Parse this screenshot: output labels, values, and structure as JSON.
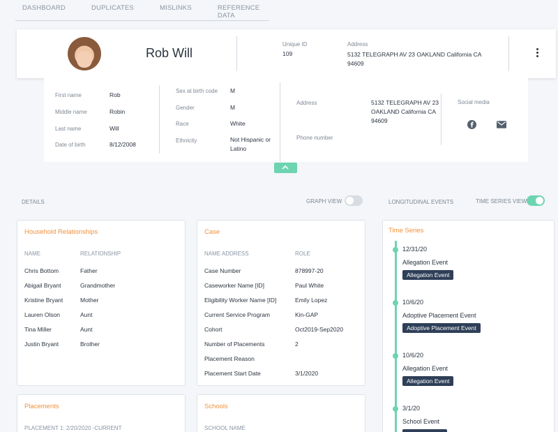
{
  "nav": {
    "tabs": [
      "DASHBOARD",
      "DUPLICATES",
      "MISLINKS",
      "REFERENCE DATA"
    ]
  },
  "profile": {
    "name": "Rob Will",
    "unique_id_label": "Unique ID",
    "unique_id": "109",
    "address_label": "Address",
    "address_line1": "5132 TELEGRAPH AV 23 OAKLAND California CA",
    "address_line2": "94609"
  },
  "details": {
    "first_name_label": "First name",
    "first_name": "Rob",
    "middle_name_label": "Middle name",
    "middle_name": "Robin",
    "last_name_label": "Last name",
    "last_name": "Will",
    "dob_label": "Date of birth",
    "dob": "8/12/2008",
    "sex_label": "Sex at birth code",
    "sex": "M",
    "gender_label": "Gender",
    "gender": "M",
    "race_label": "Race",
    "race": "White",
    "ethnicity_label": "Ethnicity",
    "ethnicity_line1": "Not Hispanic or",
    "ethnicity_line2": "Latino",
    "address_label": "Address",
    "address_line1": "5132 TELEGRAPH AV 23",
    "address_line2": "OAKLAND California CA",
    "address_line3": "94609",
    "phone_label": "Phone number",
    "social_label": "Social media",
    "social_icons": [
      "facebook-icon",
      "mail-icon"
    ]
  },
  "section": {
    "details_label": "DETAILS",
    "graph_view_label": "GRAPH VIEW",
    "graph_view_on": false,
    "longitudinal_label": "LONGITUDINAL EVENTS",
    "time_series_view_label": "TIME SERIES VIEW",
    "time_series_view_on": true
  },
  "household": {
    "title": "Household Relationships",
    "col_name": "NAME",
    "col_relationship": "RELATIONSHIP",
    "rows": [
      {
        "name": "Chris Bottom",
        "relationship": "Father"
      },
      {
        "name": "Abigail Bryant",
        "relationship": "Grandmother"
      },
      {
        "name": "Kristine Bryant",
        "relationship": "Mother"
      },
      {
        "name": "Lauren Olson",
        "relationship": "Aunt"
      },
      {
        "name": "Tina Miller",
        "relationship": "Aunt"
      },
      {
        "name": "Justin Bryant",
        "relationship": "Brother"
      }
    ]
  },
  "case": {
    "title": "Case",
    "col_name": "NAME ADDRESS",
    "col_role": "ROLE",
    "rows": [
      {
        "name": "Case Number",
        "role": "878997-20"
      },
      {
        "name": "Caseworker Name [ID]",
        "role": "Paul White"
      },
      {
        "name": "Eligibility Worker Name [ID]",
        "role": "Emily Lopez"
      },
      {
        "name": "Current Service Program",
        "role": "Kin-GAP"
      },
      {
        "name": "Cohort",
        "role": "Oct2019-Sep2020"
      },
      {
        "name": "Number of Placements",
        "role": "2"
      },
      {
        "name": "Placement Reason",
        "role": ""
      },
      {
        "name": "Placement Start Date",
        "role": "3/1/2020"
      }
    ]
  },
  "placements": {
    "title": "Placements",
    "first_item": "PLACEMENT 1: 2/20/2020 -CURRENT"
  },
  "schools": {
    "title": "Schools",
    "col_name": "SCHOOL NAME"
  },
  "timeseries": {
    "title": "Time Series",
    "events": [
      {
        "date": "12/31/20",
        "title": "Allegation Event",
        "badge": "Allegation Event"
      },
      {
        "date": "10/6/20",
        "title": "Adoptive Placement Event",
        "badge": "Adoptive Placement Event"
      },
      {
        "date": "10/6/20",
        "title": "Allegation Event",
        "badge": "Allegation Event"
      },
      {
        "date": "3/1/20",
        "title": "School Event",
        "badge": ""
      }
    ]
  },
  "colors": {
    "accent": "#6dd4b0",
    "title_orange": "#f0913a",
    "badge_navy": "#2e3f57"
  }
}
